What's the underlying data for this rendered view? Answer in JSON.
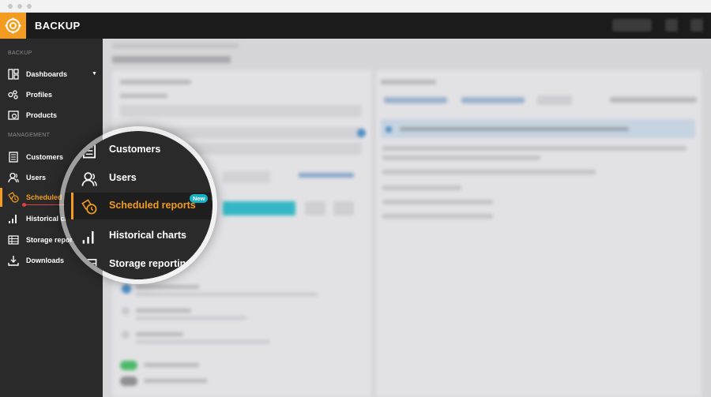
{
  "app": {
    "title": "BACKUP"
  },
  "colors": {
    "accent": "#f39c1f",
    "sidebar": "#2a2a2a",
    "header": "#1b1b1b",
    "badge": "#17b1c4",
    "pointer": "#e0413d"
  },
  "sidebar": {
    "section_backup": "BACKUP",
    "section_management": "MANAGEMENT",
    "items": [
      {
        "label": "Dashboards",
        "icon": "dashboard-icon"
      },
      {
        "label": "Profiles",
        "icon": "profiles-icon"
      },
      {
        "label": "Products",
        "icon": "products-icon"
      },
      {
        "label": "Customers",
        "icon": "customers-icon"
      },
      {
        "label": "Users",
        "icon": "users-icon"
      },
      {
        "label": "Scheduled re",
        "icon": "scheduled-reports-icon",
        "active": true
      },
      {
        "label": "Historical cha",
        "icon": "historical-charts-icon"
      },
      {
        "label": "Storage reportin",
        "icon": "storage-reporting-icon"
      },
      {
        "label": "Downloads",
        "icon": "downloads-icon"
      }
    ]
  },
  "magnifier": {
    "items": [
      {
        "label": "Customers",
        "icon": "customers-icon"
      },
      {
        "label": "Users",
        "icon": "users-icon"
      },
      {
        "label": "Scheduled reports",
        "icon": "scheduled-reports-icon",
        "badge": "New",
        "active": true
      },
      {
        "label": "Historical charts",
        "icon": "historical-charts-icon"
      },
      {
        "label": "Storage reporting",
        "icon": "storage-reporting-icon"
      }
    ]
  }
}
